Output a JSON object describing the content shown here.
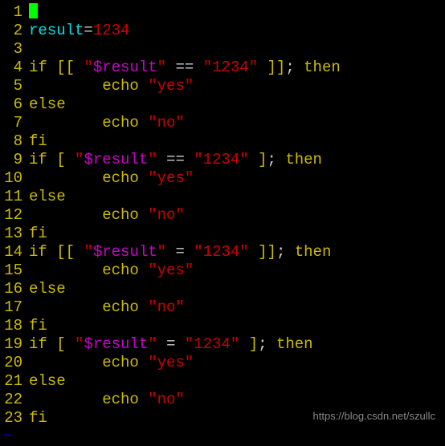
{
  "editor": {
    "lines": [
      {
        "n": "1",
        "tokens": [
          {
            "t": "cursor",
            "v": " "
          }
        ]
      },
      {
        "n": "2",
        "tokens": [
          {
            "c": "cyan",
            "v": "result"
          },
          {
            "c": "default",
            "v": "="
          },
          {
            "c": "red",
            "v": "1234"
          }
        ]
      },
      {
        "n": "3",
        "tokens": []
      },
      {
        "n": "4",
        "tokens": [
          {
            "c": "yellow",
            "v": "if"
          },
          {
            "c": "default",
            "v": " "
          },
          {
            "c": "yellow",
            "v": "[["
          },
          {
            "c": "default",
            "v": " "
          },
          {
            "c": "red",
            "v": "\""
          },
          {
            "c": "magenta",
            "v": "$result"
          },
          {
            "c": "red",
            "v": "\""
          },
          {
            "c": "default",
            "v": " == "
          },
          {
            "c": "red",
            "v": "\"1234\""
          },
          {
            "c": "default",
            "v": " "
          },
          {
            "c": "yellow",
            "v": "]]"
          },
          {
            "c": "default",
            "v": "; "
          },
          {
            "c": "yellow",
            "v": "then"
          }
        ]
      },
      {
        "n": "5",
        "tokens": [
          {
            "c": "default",
            "v": "        "
          },
          {
            "c": "yellow",
            "v": "echo"
          },
          {
            "c": "default",
            "v": " "
          },
          {
            "c": "red",
            "v": "\"yes\""
          }
        ]
      },
      {
        "n": "6",
        "tokens": [
          {
            "c": "yellow",
            "v": "else"
          }
        ]
      },
      {
        "n": "7",
        "tokens": [
          {
            "c": "default",
            "v": "        "
          },
          {
            "c": "yellow",
            "v": "echo"
          },
          {
            "c": "default",
            "v": " "
          },
          {
            "c": "red",
            "v": "\"no\""
          }
        ]
      },
      {
        "n": "8",
        "tokens": [
          {
            "c": "yellow",
            "v": "fi"
          }
        ]
      },
      {
        "n": "9",
        "tokens": [
          {
            "c": "yellow",
            "v": "if"
          },
          {
            "c": "default",
            "v": " "
          },
          {
            "c": "yellow",
            "v": "["
          },
          {
            "c": "default",
            "v": " "
          },
          {
            "c": "red",
            "v": "\""
          },
          {
            "c": "magenta",
            "v": "$result"
          },
          {
            "c": "red",
            "v": "\""
          },
          {
            "c": "default",
            "v": " == "
          },
          {
            "c": "red",
            "v": "\"1234\""
          },
          {
            "c": "default",
            "v": " "
          },
          {
            "c": "yellow",
            "v": "]"
          },
          {
            "c": "default",
            "v": "; "
          },
          {
            "c": "yellow",
            "v": "then"
          }
        ]
      },
      {
        "n": "10",
        "tokens": [
          {
            "c": "default",
            "v": "        "
          },
          {
            "c": "yellow",
            "v": "echo"
          },
          {
            "c": "default",
            "v": " "
          },
          {
            "c": "red",
            "v": "\"yes\""
          }
        ]
      },
      {
        "n": "11",
        "tokens": [
          {
            "c": "yellow",
            "v": "else"
          }
        ]
      },
      {
        "n": "12",
        "tokens": [
          {
            "c": "default",
            "v": "        "
          },
          {
            "c": "yellow",
            "v": "echo"
          },
          {
            "c": "default",
            "v": " "
          },
          {
            "c": "red",
            "v": "\"no\""
          }
        ]
      },
      {
        "n": "13",
        "tokens": [
          {
            "c": "yellow",
            "v": "fi"
          }
        ]
      },
      {
        "n": "14",
        "tokens": [
          {
            "c": "yellow",
            "v": "if"
          },
          {
            "c": "default",
            "v": " "
          },
          {
            "c": "yellow",
            "v": "[["
          },
          {
            "c": "default",
            "v": " "
          },
          {
            "c": "red",
            "v": "\""
          },
          {
            "c": "magenta",
            "v": "$result"
          },
          {
            "c": "red",
            "v": "\""
          },
          {
            "c": "default",
            "v": " = "
          },
          {
            "c": "red",
            "v": "\"1234\""
          },
          {
            "c": "default",
            "v": " "
          },
          {
            "c": "yellow",
            "v": "]]"
          },
          {
            "c": "default",
            "v": "; "
          },
          {
            "c": "yellow",
            "v": "then"
          }
        ]
      },
      {
        "n": "15",
        "tokens": [
          {
            "c": "default",
            "v": "        "
          },
          {
            "c": "yellow",
            "v": "echo"
          },
          {
            "c": "default",
            "v": " "
          },
          {
            "c": "red",
            "v": "\"yes\""
          }
        ]
      },
      {
        "n": "16",
        "tokens": [
          {
            "c": "yellow",
            "v": "else"
          }
        ]
      },
      {
        "n": "17",
        "tokens": [
          {
            "c": "default",
            "v": "        "
          },
          {
            "c": "yellow",
            "v": "echo"
          },
          {
            "c": "default",
            "v": " "
          },
          {
            "c": "red",
            "v": "\"no\""
          }
        ]
      },
      {
        "n": "18",
        "tokens": [
          {
            "c": "yellow",
            "v": "fi"
          }
        ]
      },
      {
        "n": "19",
        "tokens": [
          {
            "c": "yellow",
            "v": "if"
          },
          {
            "c": "default",
            "v": " "
          },
          {
            "c": "yellow",
            "v": "["
          },
          {
            "c": "default",
            "v": " "
          },
          {
            "c": "red",
            "v": "\""
          },
          {
            "c": "magenta",
            "v": "$result"
          },
          {
            "c": "red",
            "v": "\""
          },
          {
            "c": "default",
            "v": " = "
          },
          {
            "c": "red",
            "v": "\"1234\""
          },
          {
            "c": "default",
            "v": " "
          },
          {
            "c": "yellow",
            "v": "]"
          },
          {
            "c": "default",
            "v": "; "
          },
          {
            "c": "yellow",
            "v": "then"
          }
        ]
      },
      {
        "n": "20",
        "tokens": [
          {
            "c": "default",
            "v": "        "
          },
          {
            "c": "yellow",
            "v": "echo"
          },
          {
            "c": "default",
            "v": " "
          },
          {
            "c": "red",
            "v": "\"yes\""
          }
        ]
      },
      {
        "n": "21",
        "tokens": [
          {
            "c": "yellow",
            "v": "else"
          }
        ]
      },
      {
        "n": "22",
        "tokens": [
          {
            "c": "default",
            "v": "        "
          },
          {
            "c": "yellow",
            "v": "echo"
          },
          {
            "c": "default",
            "v": " "
          },
          {
            "c": "red",
            "v": "\"no\""
          }
        ]
      },
      {
        "n": "23",
        "tokens": [
          {
            "c": "yellow",
            "v": "fi"
          }
        ]
      }
    ],
    "tilde": "~",
    "watermark": "https://blog.csdn.net/szullc"
  }
}
